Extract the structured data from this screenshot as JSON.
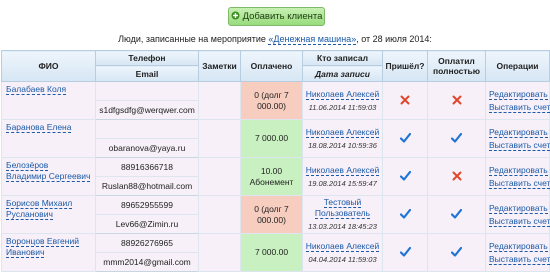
{
  "toolbar": {
    "add_client_label": "Добавить клиента"
  },
  "caption": {
    "prefix": "Люди, записанные на мероприятие ",
    "event": "«Денежная машина»",
    "suffix": ", от 28 июля 2014:"
  },
  "table": {
    "headers": {
      "fio": "ФИО",
      "phone": "Телефон",
      "email": "Email",
      "notes": "Заметки",
      "paid": "Оплачено",
      "who": "Кто записал",
      "date": "Дата записи",
      "came": "Пришёл?",
      "paid_full": "Оплатил полностью",
      "ops": "Операции"
    },
    "rows": [
      {
        "name": "Балабаев Коля",
        "phone": "",
        "email": "s1dfgsdfg@werqwer.com",
        "notes": "",
        "paid": "0 (долг 7 000.00)",
        "paid_state": "debt",
        "who": "Николаев Алексей",
        "date": "11.06.2014 11:59:03",
        "came": "no",
        "paid_full": "no",
        "edit": "Редактировать",
        "invoice": "Выставить счет"
      },
      {
        "name": "Баранова Елена",
        "phone": "",
        "email": "obaranova@yaya.ru",
        "notes": "",
        "paid": "7 000.00",
        "paid_state": "ok",
        "who": "Николаев Алексей",
        "date": "18.08.2014 10:59:36",
        "came": "yes",
        "paid_full": "yes",
        "edit": "Редактировать",
        "invoice": "Выставить счет"
      },
      {
        "name": "Белозёров Владимир Сергеевич",
        "phone": "88916366718",
        "email": "Ruslan88@hotmail.com",
        "notes": "",
        "paid": "10.00 Абонемент",
        "paid_state": "ok",
        "who": "Николаев Алексей",
        "date": "19.08.2014 15:59:47",
        "came": "yes",
        "paid_full": "no",
        "edit": "Редактировать",
        "invoice": "Выставить счет"
      },
      {
        "name": "Борисов Михаил Русланович",
        "phone": "89652955599",
        "email": "Lev66@Zimin.ru",
        "notes": "",
        "paid": "0 (долг 7 000.00)",
        "paid_state": "debt",
        "who": "Тестовый Пользователь",
        "date": "13.03.2014 18:45:23",
        "came": "yes",
        "paid_full": "yes",
        "edit": "Редактировать",
        "invoice": "Выставить счет"
      },
      {
        "name": "Воронцов Евгений Иванович",
        "phone": "88926276965",
        "email": "mmm2014@gmail.com",
        "notes": "",
        "paid": "7 000.00",
        "paid_state": "ok",
        "who": "Николаев Алексей",
        "date": "04.04.2014 11:59:03",
        "came": "yes",
        "paid_full": "yes",
        "edit": "Редактировать",
        "invoice": "Выставить счет"
      }
    ]
  },
  "colors": {
    "link": "#1a5aa8",
    "debt_bg": "#f6cdbf",
    "ok_bg": "#c9f0c0",
    "check": "#1f74d6",
    "cross": "#e2462a"
  },
  "icons": {
    "add": "plus-person-icon",
    "yes": "check-icon",
    "no": "cross-icon"
  }
}
